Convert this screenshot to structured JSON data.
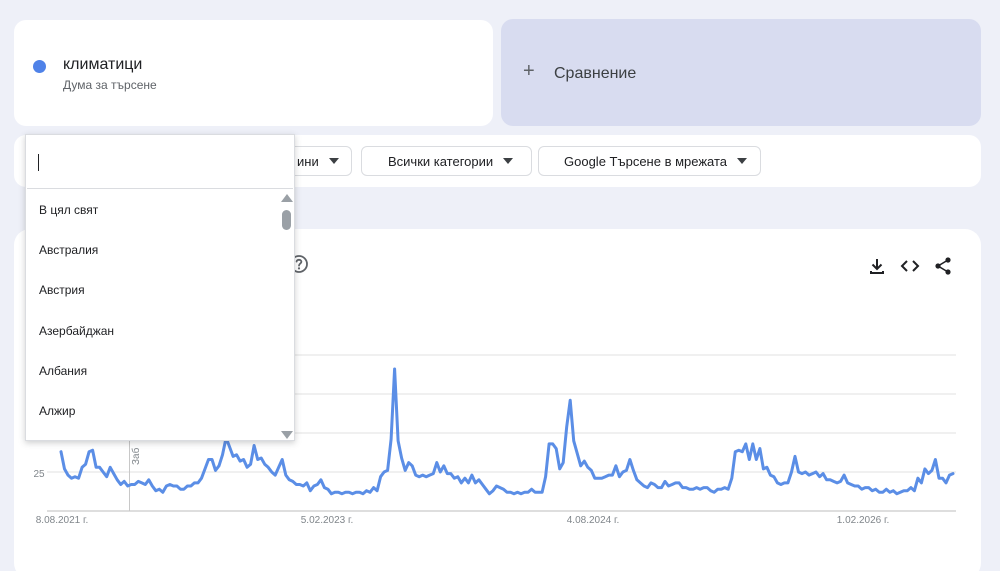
{
  "search_term": {
    "name": "климатици",
    "subtitle": "Дума за търсене",
    "color": "#4f82e8"
  },
  "compare": {
    "plus": "+",
    "label": "Сравнение"
  },
  "filters": {
    "region_partial": "ини",
    "category": "Всички категории",
    "search_type": "Google Търсене в мрежата"
  },
  "region_dropdown": {
    "search_value": "",
    "items": [
      "В цял свят",
      "Австралия",
      "Австрия",
      "Азербайджан",
      "Албания",
      "Алжир"
    ]
  },
  "chart": {
    "note_label": "Заб",
    "x_tick_labels": [
      "8.08.2021 г.",
      "5.02.2023 г.",
      "4.08.2024 г.",
      "1.02.2026 г."
    ],
    "y_tick_label": "25",
    "line_color": "#5b8ee6"
  },
  "chart_data": {
    "type": "line",
    "y_visible_label": "25",
    "series": [
      {
        "values": [
          38,
          27,
          23,
          21,
          22,
          21,
          28,
          30,
          38,
          39,
          28,
          28,
          25,
          22,
          28,
          24,
          20,
          17,
          19,
          16,
          17,
          17,
          19,
          18,
          17,
          20,
          16,
          13,
          14,
          12,
          16,
          17,
          16,
          16,
          14,
          14,
          16,
          16,
          18,
          18,
          21,
          27,
          33,
          33,
          26,
          29,
          36,
          47,
          41,
          35,
          36,
          32,
          33,
          28,
          30,
          42,
          33,
          34,
          30,
          28,
          25,
          23,
          28,
          33,
          23,
          20,
          19,
          17,
          17,
          16,
          18,
          13,
          16,
          17,
          20,
          15,
          14,
          11,
          12,
          12,
          11,
          12,
          12,
          11,
          12,
          12,
          11,
          13,
          12,
          15,
          13,
          22,
          25,
          26,
          46,
          91,
          45,
          34,
          26,
          31,
          29,
          23,
          22,
          23,
          22,
          23,
          24,
          31,
          25,
          29,
          24,
          24,
          21,
          22,
          18,
          21,
          18,
          23,
          18,
          20,
          17,
          14,
          11,
          13,
          16,
          15,
          14,
          12,
          12,
          11,
          12,
          11,
          12,
          12,
          14,
          12,
          12,
          12,
          22,
          43,
          43,
          40,
          27,
          31,
          54,
          71,
          45,
          37,
          29,
          32,
          28,
          26,
          21,
          21,
          21,
          22,
          23,
          23,
          29,
          22,
          25,
          26,
          33,
          26,
          20,
          18,
          16,
          15,
          18,
          17,
          15,
          15,
          19,
          16,
          17,
          18,
          18,
          15,
          15,
          14,
          14,
          15,
          14,
          15,
          15,
          13,
          12,
          14,
          14,
          15,
          14,
          21,
          38,
          39,
          38,
          43,
          33,
          43,
          33,
          40,
          27,
          28,
          23,
          22,
          18,
          17,
          18,
          18,
          25,
          35,
          25,
          24,
          25,
          23,
          24,
          25,
          22,
          24,
          20,
          20,
          19,
          18,
          19,
          23,
          18,
          17,
          16,
          16,
          14,
          15,
          15,
          13,
          14,
          12,
          12,
          14,
          12,
          13,
          11,
          12,
          13,
          13,
          15,
          13,
          21,
          18,
          27,
          24,
          26,
          33,
          21,
          21,
          18,
          23,
          24
        ]
      }
    ]
  }
}
